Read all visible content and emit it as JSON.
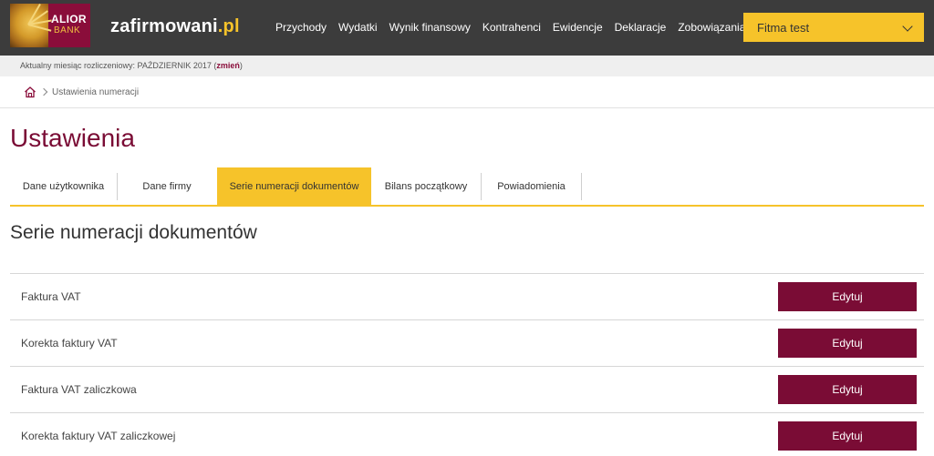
{
  "header": {
    "logo": {
      "line1": "ALIOR",
      "line2": "BANK"
    },
    "brand": {
      "name": "zafirmowani",
      "tld": ".pl"
    },
    "nav": [
      "Przychody",
      "Wydatki",
      "Wynik finansowy",
      "Kontrahenci",
      "Ewidencje",
      "Deklaracje",
      "Zobowiązania"
    ],
    "company": {
      "label": "Fitma test",
      "icon": "chevron-down-icon"
    }
  },
  "month_bar": {
    "prefix": "Aktualny miesiąc rozliczeniowy: PAŹDZIERNIK 2017 (",
    "link": "zmień",
    "suffix": ")"
  },
  "breadcrumb": {
    "home_icon": "home-icon",
    "current": "Ustawienia numeracji"
  },
  "page": {
    "title": "Ustawienia"
  },
  "tabs": [
    {
      "label": "Dane użytkownika",
      "active": false
    },
    {
      "label": "Dane firmy",
      "active": false
    },
    {
      "label": "Serie numeracji dokumentów",
      "active": true
    },
    {
      "label": "Bilans początkowy",
      "active": false
    },
    {
      "label": "Powiadomienia",
      "active": false
    }
  ],
  "section": {
    "title": "Serie numeracji dokumentów",
    "rows": [
      {
        "label": "Faktura VAT",
        "button": "Edytuj"
      },
      {
        "label": "Korekta faktury VAT",
        "button": "Edytuj"
      },
      {
        "label": "Faktura VAT zaliczkowa",
        "button": "Edytuj"
      },
      {
        "label": "Korekta faktury VAT zaliczkowej",
        "button": "Edytuj"
      }
    ]
  },
  "colors": {
    "accent_yellow": "#f6c32a",
    "brand_maroon": "#7a0c35",
    "topbar": "#3c3c3c"
  }
}
